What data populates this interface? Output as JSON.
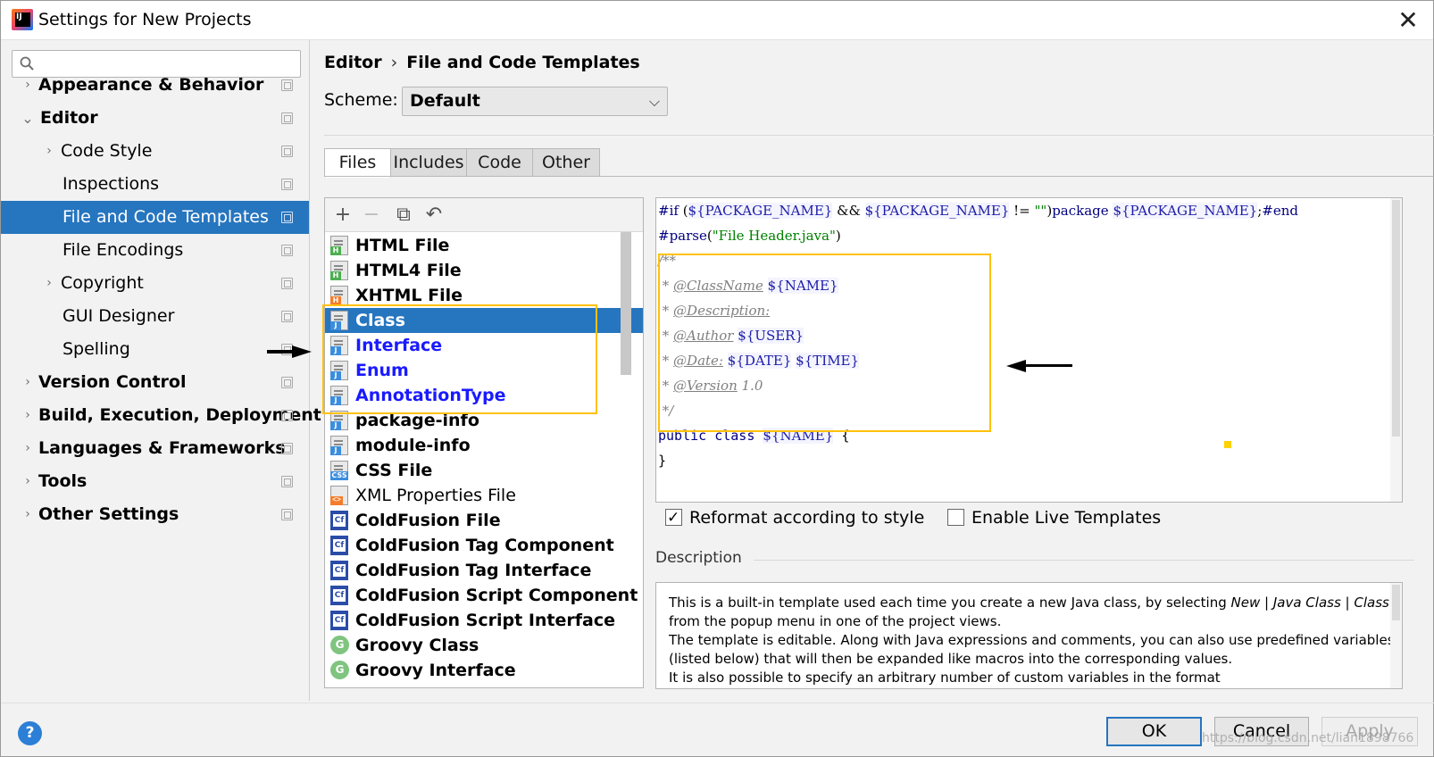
{
  "window": {
    "title": "Settings for New Projects",
    "close_glyph": "✕"
  },
  "sidebar": {
    "search_placeholder": "",
    "items": [
      {
        "label": "Appearance & Behavior",
        "bold": true,
        "expander": "›",
        "level": 0,
        "selected": false
      },
      {
        "label": "Editor",
        "bold": true,
        "expander": "⌄",
        "level": 0,
        "selected": false
      },
      {
        "label": "Code Style",
        "bold": false,
        "expander": "›",
        "level": 1,
        "selected": false
      },
      {
        "label": "Inspections",
        "bold": false,
        "expander": "",
        "level": 1,
        "selected": false
      },
      {
        "label": "File and Code Templates",
        "bold": false,
        "expander": "",
        "level": 1,
        "selected": true
      },
      {
        "label": "File Encodings",
        "bold": false,
        "expander": "",
        "level": 1,
        "selected": false
      },
      {
        "label": "Copyright",
        "bold": false,
        "expander": "›",
        "level": 1,
        "selected": false
      },
      {
        "label": "GUI Designer",
        "bold": false,
        "expander": "",
        "level": 1,
        "selected": false
      },
      {
        "label": "Spelling",
        "bold": false,
        "expander": "",
        "level": 1,
        "selected": false
      },
      {
        "label": "Version Control",
        "bold": true,
        "expander": "›",
        "level": 0,
        "selected": false
      },
      {
        "label": "Build, Execution, Deployment",
        "bold": true,
        "expander": "›",
        "level": 0,
        "selected": false
      },
      {
        "label": "Languages & Frameworks",
        "bold": true,
        "expander": "›",
        "level": 0,
        "selected": false
      },
      {
        "label": "Tools",
        "bold": true,
        "expander": "›",
        "level": 0,
        "selected": false
      },
      {
        "label": "Other Settings",
        "bold": true,
        "expander": "›",
        "level": 0,
        "selected": false
      }
    ]
  },
  "header": {
    "breadcrumb": [
      "Editor",
      "File and Code Templates"
    ],
    "breadcrumb_sep": "›",
    "scheme_label": "Scheme:",
    "scheme_value": "Default",
    "scheme_chevron": "⌵"
  },
  "tabs": [
    {
      "label": "Files",
      "active": true
    },
    {
      "label": "Includes",
      "active": false
    },
    {
      "label": "Code",
      "active": false
    },
    {
      "label": "Other",
      "active": false
    }
  ],
  "list_toolbar": [
    {
      "name": "add-icon",
      "glyph": "+"
    },
    {
      "name": "remove-icon",
      "glyph": "−"
    },
    {
      "name": "copy-icon",
      "glyph": "⧉"
    },
    {
      "name": "reset-icon",
      "glyph": "↶"
    }
  ],
  "templates": [
    {
      "label": "HTML File",
      "icon": "html-file-icon",
      "badge": "H",
      "badge_class": "b-h",
      "kind": "file",
      "style": "bold"
    },
    {
      "label": "HTML4 File",
      "icon": "html4-file-icon",
      "badge": "H",
      "badge_class": "b-h",
      "kind": "file",
      "style": "bold"
    },
    {
      "label": "XHTML File",
      "icon": "xhtml-file-icon",
      "badge": "H",
      "badge_class": "b-x",
      "kind": "file",
      "style": "bold"
    },
    {
      "label": "Class",
      "icon": "java-class-icon",
      "badge": "J",
      "badge_class": "b-j",
      "kind": "file",
      "style": "selected"
    },
    {
      "label": "Interface",
      "icon": "java-interface-icon",
      "badge": "J",
      "badge_class": "b-j",
      "kind": "file",
      "style": "blue"
    },
    {
      "label": "Enum",
      "icon": "java-enum-icon",
      "badge": "J",
      "badge_class": "b-j",
      "kind": "file",
      "style": "blue"
    },
    {
      "label": "AnnotationType",
      "icon": "java-annotation-icon",
      "badge": "J",
      "badge_class": "b-j",
      "kind": "file",
      "style": "blue"
    },
    {
      "label": "package-info",
      "icon": "java-package-info-icon",
      "badge": "J",
      "badge_class": "b-j",
      "kind": "file",
      "style": "bold"
    },
    {
      "label": "module-info",
      "icon": "java-module-info-icon",
      "badge": "J",
      "badge_class": "b-j",
      "kind": "file",
      "style": "bold"
    },
    {
      "label": "CSS File",
      "icon": "css-file-icon",
      "badge": "CSS",
      "badge_class": "b-css",
      "kind": "file",
      "style": "bold"
    },
    {
      "label": "XML Properties File",
      "icon": "xml-file-icon",
      "badge": "<>",
      "badge_class": "",
      "kind": "xml",
      "style": "plain"
    },
    {
      "label": "ColdFusion File",
      "icon": "coldfusion-icon",
      "badge": "",
      "badge_class": "",
      "kind": "cf",
      "style": "bold"
    },
    {
      "label": "ColdFusion Tag Component",
      "icon": "coldfusion-icon",
      "badge": "",
      "badge_class": "",
      "kind": "cf",
      "style": "bold"
    },
    {
      "label": "ColdFusion Tag Interface",
      "icon": "coldfusion-icon",
      "badge": "",
      "badge_class": "",
      "kind": "cf",
      "style": "bold"
    },
    {
      "label": "ColdFusion Script Component",
      "icon": "coldfusion-icon",
      "badge": "",
      "badge_class": "",
      "kind": "cf",
      "style": "bold"
    },
    {
      "label": "ColdFusion Script Interface",
      "icon": "coldfusion-icon",
      "badge": "",
      "badge_class": "",
      "kind": "cf",
      "style": "bold"
    },
    {
      "label": "Groovy Class",
      "icon": "groovy-icon",
      "badge": "",
      "badge_class": "",
      "kind": "groovy",
      "style": "bold"
    },
    {
      "label": "Groovy Interface",
      "icon": "groovy-icon",
      "badge": "",
      "badge_class": "",
      "kind": "groovy",
      "style": "bold"
    }
  ],
  "code": {
    "line1": [
      {
        "t": "#if",
        "c": "kw"
      },
      {
        "t": " (",
        "c": ""
      },
      {
        "t": "${PACKAGE_NAME}",
        "c": "var"
      },
      {
        "t": " && ",
        "c": ""
      },
      {
        "t": "${PACKAGE_NAME}",
        "c": "var"
      },
      {
        "t": " != ",
        "c": ""
      },
      {
        "t": "\"\"",
        "c": "str"
      },
      {
        "t": ")",
        "c": ""
      },
      {
        "t": "package ",
        "c": "kw"
      },
      {
        "t": "${PACKAGE_NAME}",
        "c": "var"
      },
      {
        "t": ";",
        "c": ""
      },
      {
        "t": "#end",
        "c": "kw"
      }
    ],
    "line2": [
      {
        "t": "#parse",
        "c": "kw"
      },
      {
        "t": "(",
        "c": ""
      },
      {
        "t": "\"File Header.java\"",
        "c": "str"
      },
      {
        "t": ")",
        "c": ""
      }
    ],
    "line3": [
      {
        "t": "/**",
        "c": "cm"
      }
    ],
    "line4": [
      {
        "t": " * ",
        "c": "cm"
      },
      {
        "t": "@ClassName",
        "c": "tag"
      },
      {
        "t": " ",
        "c": ""
      },
      {
        "t": "${NAME}",
        "c": "var"
      }
    ],
    "line5": [
      {
        "t": " * ",
        "c": "cm"
      },
      {
        "t": "@Description:",
        "c": "tag"
      }
    ],
    "line6": [
      {
        "t": " * ",
        "c": "cm"
      },
      {
        "t": "@Author",
        "c": "tag"
      },
      {
        "t": " ",
        "c": ""
      },
      {
        "t": "${USER}",
        "c": "var"
      }
    ],
    "line7": [
      {
        "t": " * ",
        "c": "cm"
      },
      {
        "t": "@Date:",
        "c": "tag"
      },
      {
        "t": " ",
        "c": ""
      },
      {
        "t": "${DATE}",
        "c": "var"
      },
      {
        "t": " ",
        "c": ""
      },
      {
        "t": "${TIME}",
        "c": "var"
      }
    ],
    "line8": [
      {
        "t": " * ",
        "c": "cm"
      },
      {
        "t": "@Version",
        "c": "tag"
      },
      {
        "t": " 1.0",
        "c": "cm"
      }
    ],
    "line9": [
      {
        "t": " */",
        "c": "cm"
      }
    ],
    "line10": [
      {
        "t": "public class ",
        "c": "kw mono"
      },
      {
        "t": "${NAME}",
        "c": "var"
      },
      {
        "t": " {",
        "c": "mono"
      }
    ],
    "line11": [
      {
        "t": "}",
        "c": "mono"
      }
    ]
  },
  "options": {
    "reformat": {
      "label": "Reformat according to style",
      "checked": true
    },
    "live_templates": {
      "label": "Enable Live Templates",
      "checked": false
    }
  },
  "description": {
    "title": "Description",
    "lines": [
      "This is a built-in template used each time you create a new Java class, by selecting <i>New</i> | <i>Java Class</i> | <i>Class</i>",
      "from the popup menu in one of the project views.",
      "The template is editable. Along with Java expressions and comments, you can also use predefined variables",
      "(listed below) that will then be expanded like macros into the corresponding values.",
      "It is also possible to specify an arbitrary number of custom variables in the format"
    ]
  },
  "buttons": {
    "help": "?",
    "ok": "OK",
    "cancel": "Cancel",
    "apply": "Apply"
  },
  "watermark": "https://blog.csdn.net/lian1898766",
  "colors": {
    "accent": "#2675bf",
    "highlight_box": "#ffc107",
    "link_blue": "#1a1aff"
  }
}
